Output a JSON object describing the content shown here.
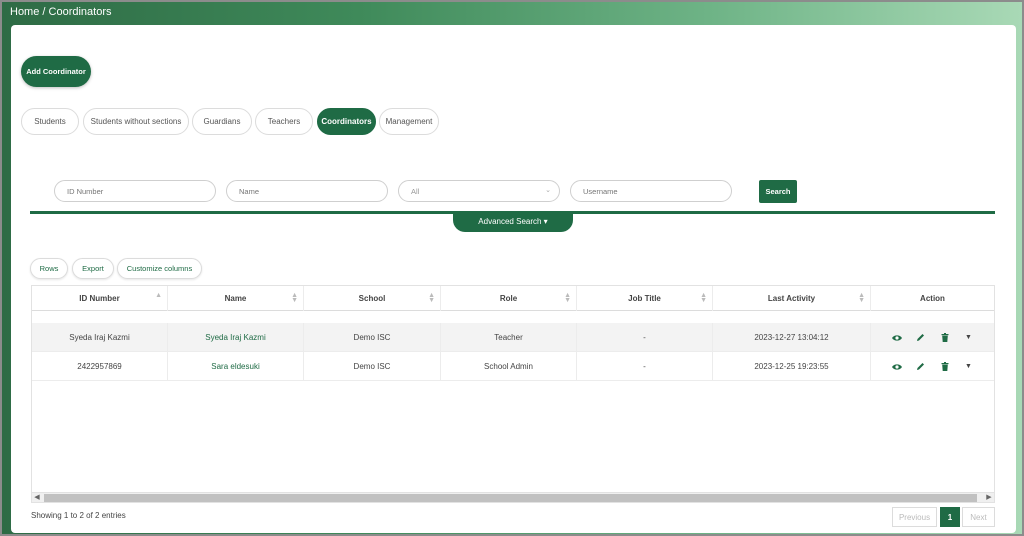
{
  "breadcrumb": "Home / Coordinators",
  "add_button": "Add Coordinator",
  "tabs": [
    {
      "label": "Students"
    },
    {
      "label": "Students without sections"
    },
    {
      "label": "Guardians"
    },
    {
      "label": "Teachers"
    },
    {
      "label": "Coordinators",
      "active": true
    },
    {
      "label": "Management"
    }
  ],
  "filters": {
    "id_placeholder": "ID Number",
    "name_placeholder": "Name",
    "select_value": "All",
    "username_placeholder": "Username",
    "search_label": "Search"
  },
  "advanced_search": "Advanced Search ▾",
  "toolbar": {
    "rows": "Rows",
    "export": "Export",
    "customize": "Customize columns"
  },
  "table": {
    "columns": [
      "ID Number",
      "Name",
      "School",
      "Role",
      "Job Title",
      "Last Activity",
      "Action"
    ],
    "rows": [
      [
        "Syeda Iraj Kazmi",
        "Syeda Iraj Kazmi",
        "Demo ISC",
        "Teacher",
        "-",
        "2023-12-27 13:04:12"
      ],
      [
        "2422957869",
        "Sara eldesuki",
        "Demo ISC",
        "School Admin",
        "-",
        "2023-12-25 19:23:55"
      ]
    ],
    "action_icons": [
      "eye-icon",
      "pencil-icon",
      "trash-icon",
      "caret-down-icon"
    ]
  },
  "footer": {
    "info": "Showing 1 to 2 of 2 entries",
    "previous": "Previous",
    "page": "1",
    "next": "Next"
  },
  "colors": {
    "accent": "#1f6b45"
  }
}
